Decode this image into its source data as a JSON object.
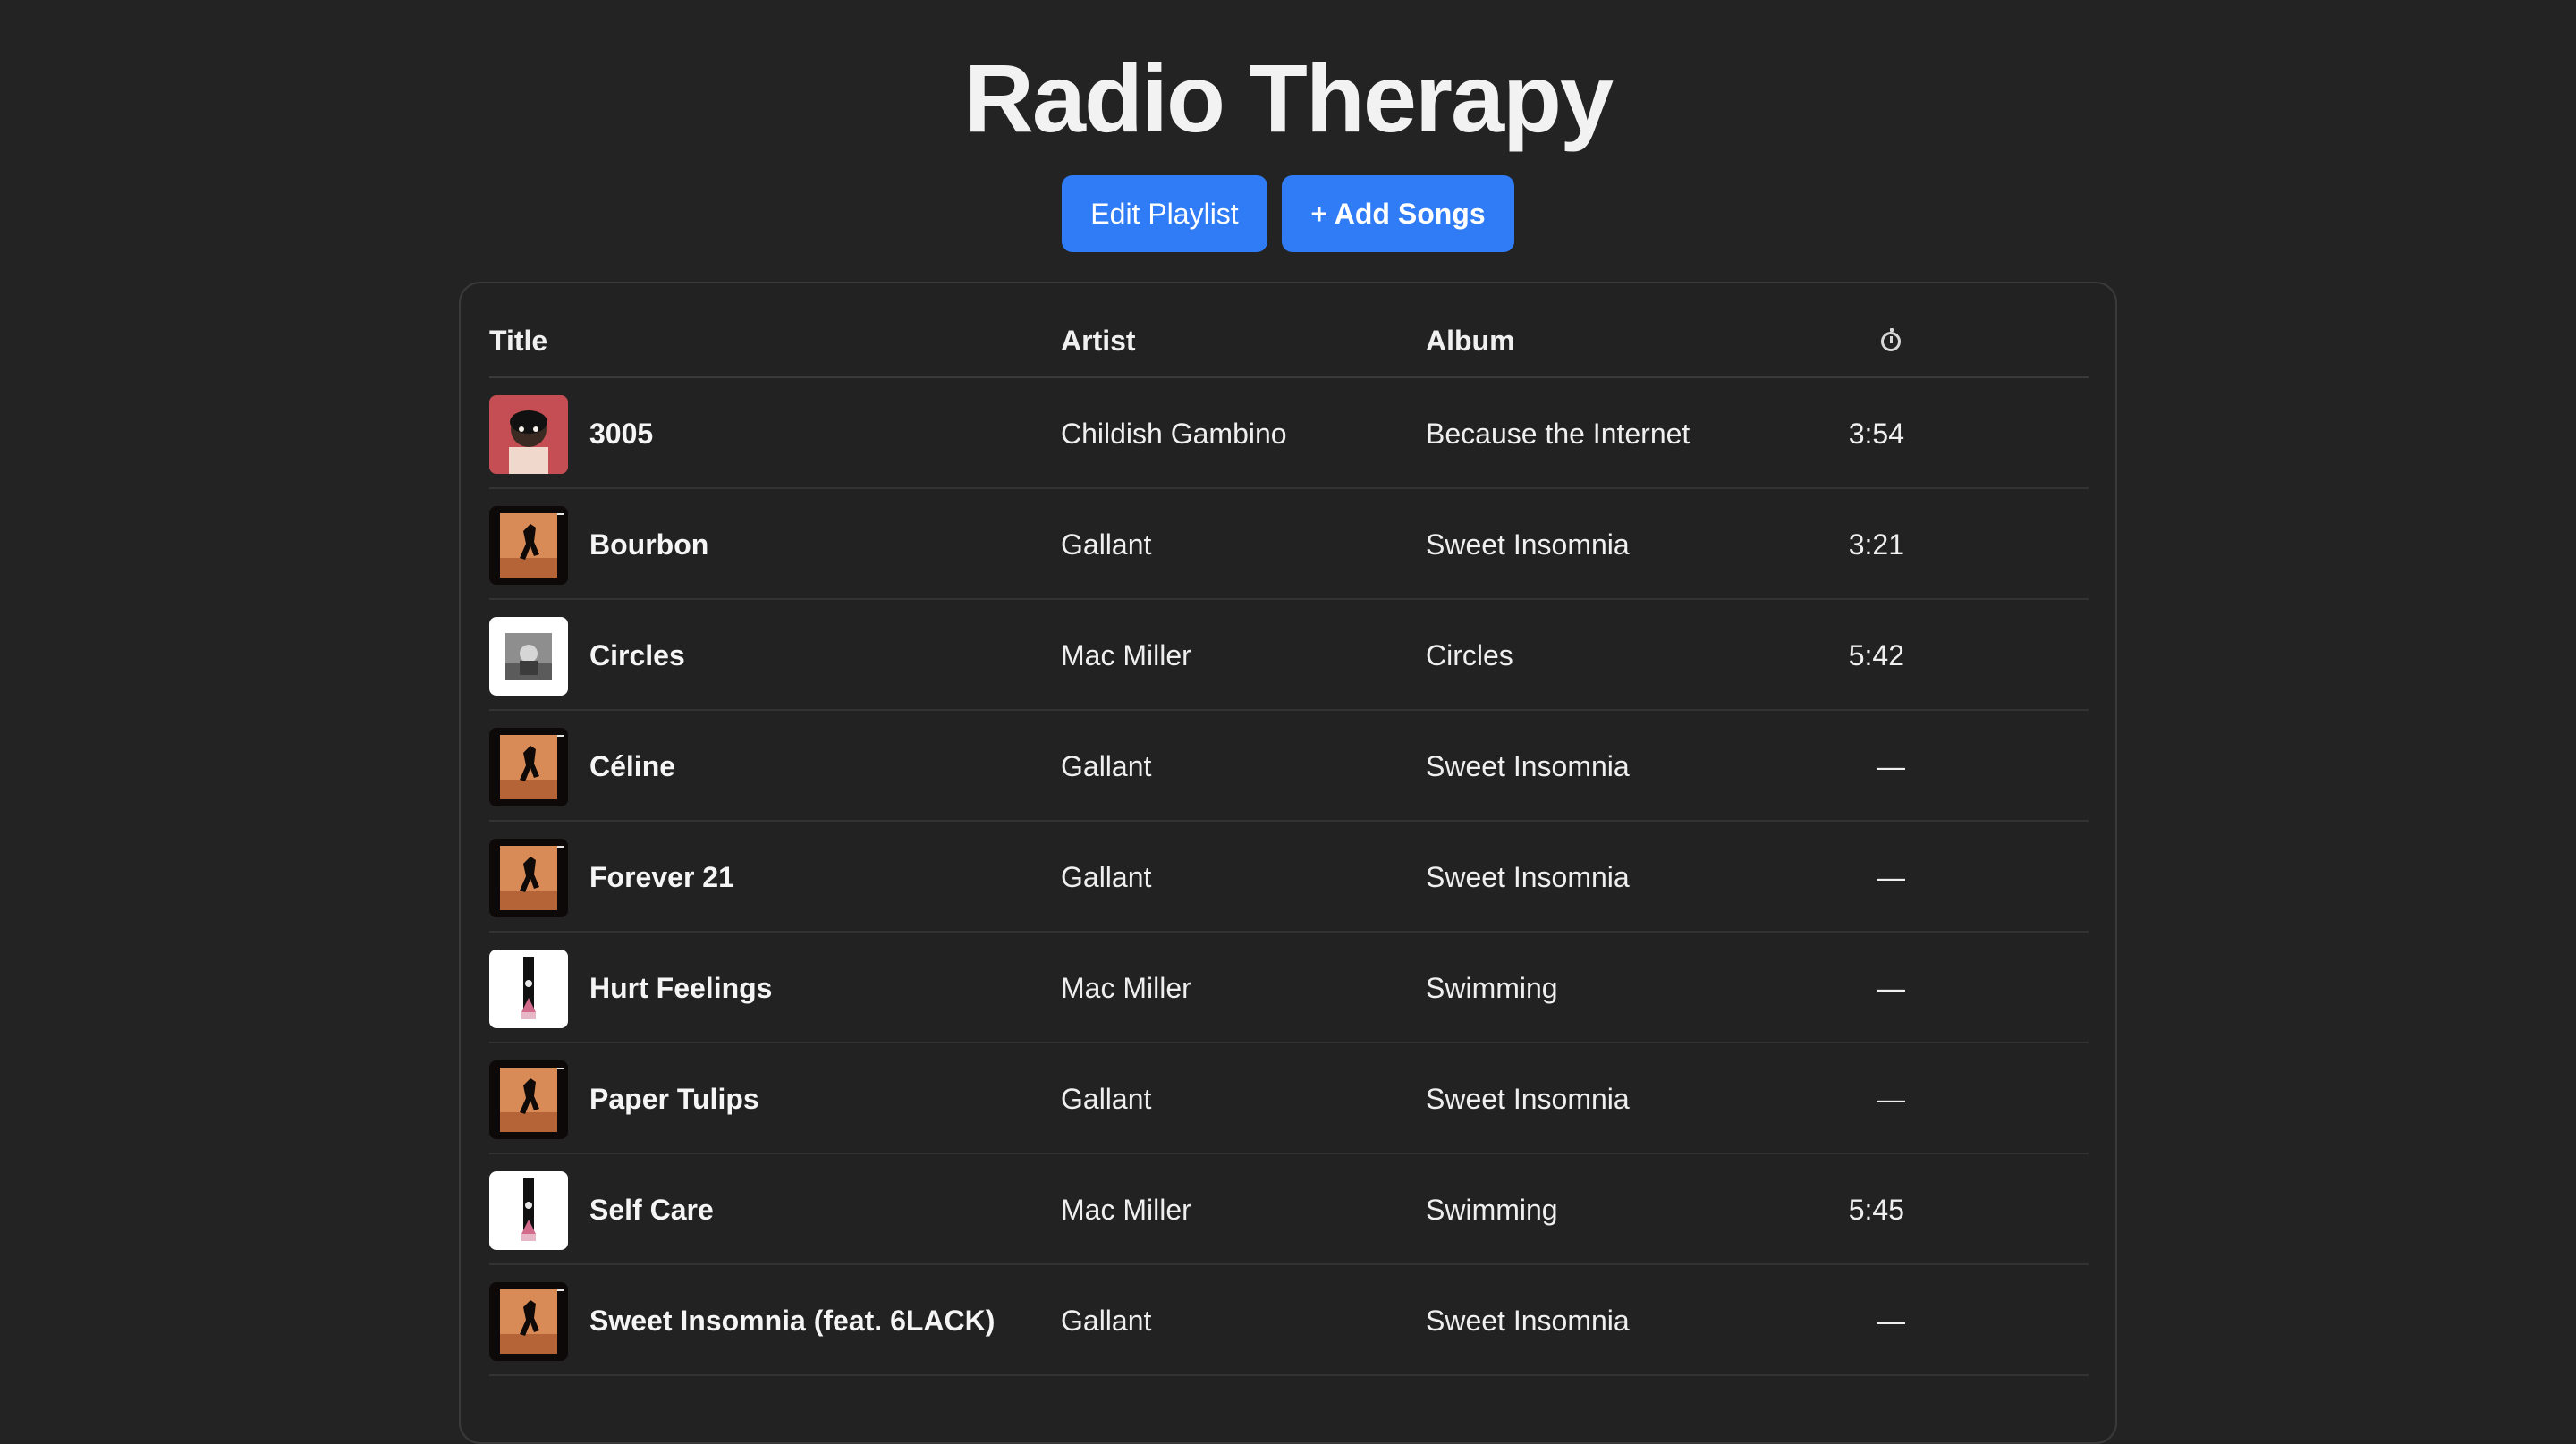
{
  "page": {
    "title": "Radio Therapy"
  },
  "actions": {
    "edit_label": "Edit Playlist",
    "add_label": "+ Add Songs"
  },
  "table": {
    "headers": {
      "title": "Title",
      "artist": "Artist",
      "album": "Album",
      "duration_icon": "clock-icon"
    },
    "rows": [
      {
        "title": "3005",
        "artist": "Childish Gambino",
        "album": "Because the Internet",
        "duration": "3:54",
        "cover": "because-the-internet-cover"
      },
      {
        "title": "Bourbon",
        "artist": "Gallant",
        "album": "Sweet Insomnia",
        "duration": "3:21",
        "cover": "sweet-insomnia-cover"
      },
      {
        "title": "Circles",
        "artist": "Mac Miller",
        "album": "Circles",
        "duration": "5:42",
        "cover": "circles-cover"
      },
      {
        "title": "Céline",
        "artist": "Gallant",
        "album": "Sweet Insomnia",
        "duration": "—",
        "cover": "sweet-insomnia-cover"
      },
      {
        "title": "Forever 21",
        "artist": "Gallant",
        "album": "Sweet Insomnia",
        "duration": "—",
        "cover": "sweet-insomnia-cover"
      },
      {
        "title": "Hurt Feelings",
        "artist": "Mac Miller",
        "album": "Swimming",
        "duration": "—",
        "cover": "swimming-cover"
      },
      {
        "title": "Paper Tulips",
        "artist": "Gallant",
        "album": "Sweet Insomnia",
        "duration": "—",
        "cover": "sweet-insomnia-cover"
      },
      {
        "title": "Self Care",
        "artist": "Mac Miller",
        "album": "Swimming",
        "duration": "5:45",
        "cover": "swimming-cover"
      },
      {
        "title": "Sweet Insomnia (feat. 6LACK)",
        "artist": "Gallant",
        "album": "Sweet Insomnia",
        "duration": "—",
        "cover": "sweet-insomnia-cover"
      }
    ]
  },
  "colors": {
    "background": "#232323",
    "accent": "#2f7cf6",
    "panel_border": "#3a3a3a"
  }
}
